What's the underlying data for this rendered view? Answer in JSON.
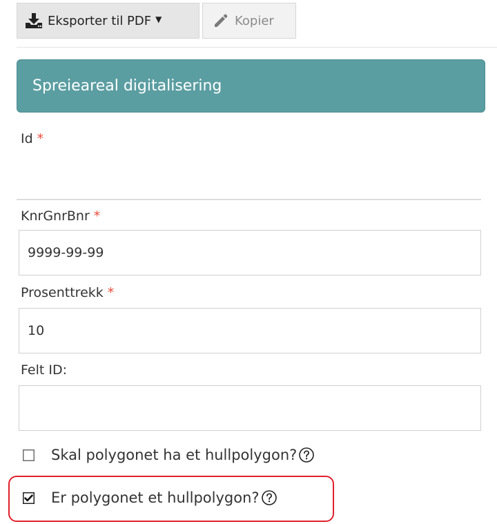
{
  "toolbar": {
    "export_label": "Eksporter til PDF",
    "copy_label": "Kopier"
  },
  "panel": {
    "title": "Spreieareal digitalisering"
  },
  "fields": {
    "id": {
      "label": "Id",
      "required_mark": "*"
    },
    "knr": {
      "label": "KnrGnrBnr",
      "required_mark": "*",
      "value": "9999-99-99"
    },
    "prosent": {
      "label": "Prosenttrekk",
      "required_mark": "*",
      "value": "10"
    },
    "felt": {
      "label": "Felt ID:",
      "value": ""
    }
  },
  "checkboxes": [
    {
      "label": "Skal polygonet ha et hullpolygon?",
      "checked": false
    },
    {
      "label": "Er polygonet et hullpolygon?",
      "checked": true
    }
  ],
  "colors": {
    "panel_header": "#5b9ea2",
    "required": "#e74c3c",
    "highlight": "#e0202c"
  }
}
